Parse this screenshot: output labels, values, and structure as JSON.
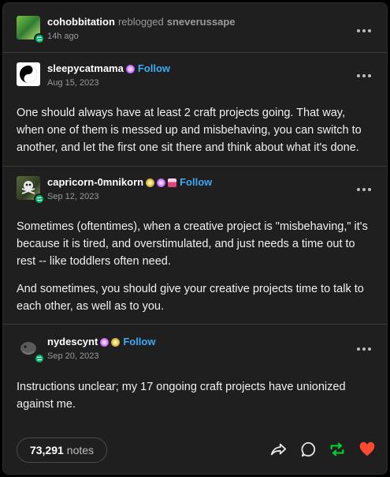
{
  "reblog_header": {
    "user": "cohobbitation",
    "action": "reblogged",
    "source": "sneverussape",
    "time": "14h ago"
  },
  "posts": [
    {
      "user": "sleepycatmama",
      "follow": "Follow",
      "date": "Aug 15, 2023",
      "paragraphs": [
        "One should always have at least 2 craft projects going.  That way, when one of them is messed up and misbehaving, you can switch to another, and let the first one sit there and think about what it's done."
      ]
    },
    {
      "user": "capricorn-0mnikorn",
      "follow": "Follow",
      "date": "Sep 12, 2023",
      "paragraphs": [
        "Sometimes (oftentimes), when a creative project is \"misbehaving,\" it's because it is tired, and overstimulated, and just needs a time out to rest -- like toddlers often need.",
        "And sometimes, you should give your creative projects time to talk to each other, as well as to you."
      ]
    },
    {
      "user": "nydescynt",
      "follow": "Follow",
      "date": "Sep 20, 2023",
      "paragraphs": [
        "Instructions unclear; my 17 ongoing craft projects have unionized against me."
      ]
    }
  ],
  "footer": {
    "notes_count": "73,291",
    "notes_label": "notes"
  },
  "colors": {
    "follow": "#3fa9f5",
    "reblog": "#00cf35",
    "like": "#ff4930"
  }
}
